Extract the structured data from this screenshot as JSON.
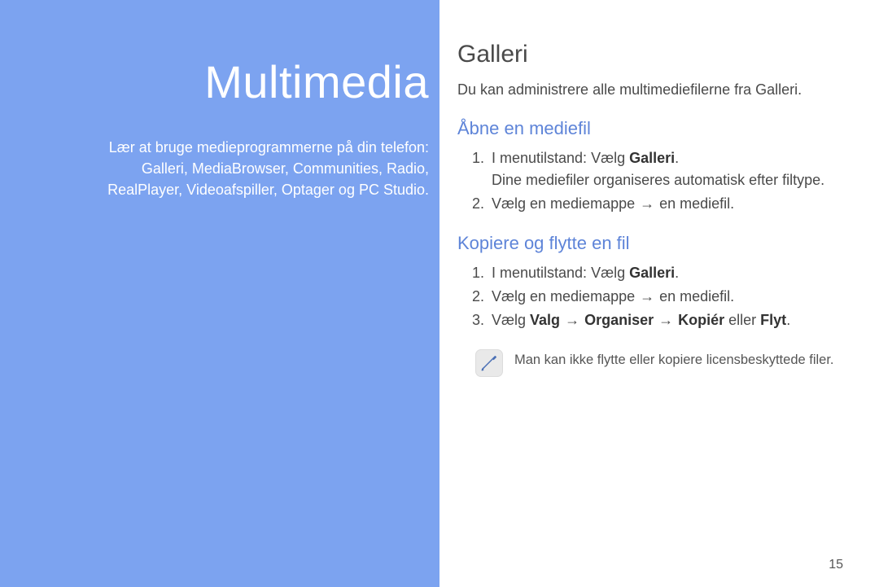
{
  "left": {
    "title": "Multimedia",
    "desc_line1": "Lær at bruge medieprogrammerne på din telefon:",
    "desc_line2": "Galleri, MediaBrowser, Communities, Radio,",
    "desc_line3": "RealPlayer, Videoafspiller, Optager og PC Studio."
  },
  "right": {
    "h1": "Galleri",
    "intro": "Du kan administrere alle multimediefilerne fra Galleri.",
    "sec1": {
      "title": "Åbne en mediefil",
      "step1_a": "I menutilstand: Vælg ",
      "step1_bold": "Galleri",
      "step1_b": ".",
      "step1_sub": "Dine mediefiler organiseres automatisk efter filtype.",
      "step2_a": "Vælg en mediemappe ",
      "step2_arrow": "→",
      "step2_b": " en mediefil."
    },
    "sec2": {
      "title": "Kopiere og flytte en fil",
      "step1_a": "I menutilstand: Vælg ",
      "step1_bold": "Galleri",
      "step1_b": ".",
      "step2_a": "Vælg en mediemappe ",
      "step2_arrow": "→",
      "step2_b": " en mediefil.",
      "step3_a": "Vælg ",
      "step3_bold1": "Valg",
      "step3_arrow1": " → ",
      "step3_bold2": "Organiser",
      "step3_arrow2": " → ",
      "step3_bold3": "Kopiér",
      "step3_mid": " eller ",
      "step3_bold4": "Flyt",
      "step3_end": "."
    },
    "note": "Man kan ikke flytte eller kopiere licensbeskyttede filer.",
    "page_number": "15"
  }
}
